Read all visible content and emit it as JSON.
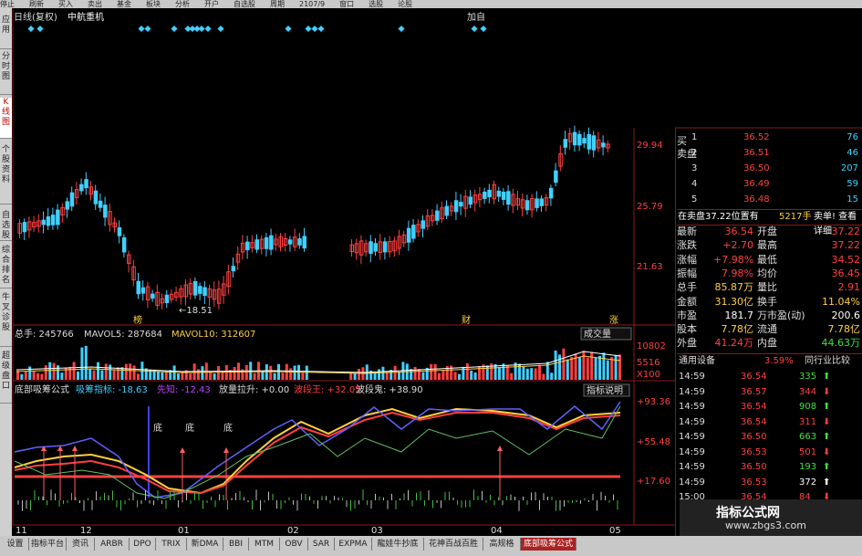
{
  "menubar": [
    "停止",
    "刷新",
    "买入",
    "卖出",
    "基金",
    "板块",
    "分析",
    "开户",
    "自选股",
    "周期",
    "2107/9",
    "窗口",
    "选股",
    "论股"
  ],
  "sidebar": [
    {
      "label": "应用",
      "active": false
    },
    {
      "label": "分时图",
      "active": false
    },
    {
      "label": "K线图",
      "active": true
    },
    {
      "label": "个股资料",
      "active": false
    },
    {
      "label": "自选股",
      "active": false
    },
    {
      "label": "综合排名",
      "active": false
    },
    {
      "label": "牛叉诊股",
      "active": false
    },
    {
      "label": "超级盘口",
      "active": false
    }
  ],
  "chart": {
    "period": "日线(复权)",
    "stock_name": "中航重机",
    "add_label": "加自",
    "price_axis": [
      "29.94",
      "25.79",
      "21.63"
    ],
    "low_marker": "←18.51",
    "event_marks": [
      "榜",
      "财",
      "涨"
    ]
  },
  "volume_panel": {
    "total": "总手: 245766",
    "mavol5": "MAVOL5: 287684",
    "mavol10": "MAVOL10: 312607",
    "dropdown": "成交量",
    "axis": [
      "10802",
      "5516",
      "X100"
    ]
  },
  "indicator_panel": {
    "name": "底部吸筹公式",
    "absorb": "吸筹指标: -18.63",
    "pioneer": "先知: -12.43",
    "volume_up": "放量拉升: +0.00",
    "bull": "波段王: +32.05",
    "wave": "波段鬼: +38.90",
    "help_button": "指标说明",
    "axis": [
      "+93.36",
      "+55.48",
      "+17.60"
    ],
    "bottom_marks": [
      "底",
      "底",
      "底"
    ],
    "dates": [
      "11",
      "12",
      "01",
      "02",
      "03",
      "04",
      "05"
    ]
  },
  "orderbook": {
    "sell_label": "卖盘",
    "buy_label": "买",
    "sell": [
      {
        "level": "1",
        "price": "36.52",
        "vol": "76"
      },
      {
        "level": "2",
        "price": "36.51",
        "vol": "46"
      },
      {
        "level": "3",
        "price": "36.50",
        "vol": "207"
      },
      {
        "level": "4",
        "price": "36.49",
        "vol": "59"
      },
      {
        "level": "5",
        "price": "36.48",
        "vol": "15"
      }
    ],
    "summary_left": "在卖盘37.22位置有",
    "summary_mid": "5217手",
    "summary_right": "卖单! 查看详细"
  },
  "quote": [
    {
      "k": "最新",
      "v": "36.54",
      "vc": "red",
      "k2": "开盘",
      "v2": "37.22",
      "v2c": "red"
    },
    {
      "k": "涨跌",
      "v": "+2.70",
      "vc": "red",
      "k2": "最高",
      "v2": "37.22",
      "v2c": "red"
    },
    {
      "k": "涨幅",
      "v": "+7.98%",
      "vc": "red",
      "k2": "最低",
      "v2": "34.52",
      "v2c": "red"
    },
    {
      "k": "振幅",
      "v": "7.98%",
      "vc": "red",
      "k2": "均价",
      "v2": "36.45",
      "v2c": "red"
    },
    {
      "k": "总手",
      "v": "85.87万",
      "vc": "yellow",
      "k2": "量比",
      "v2": "2.91",
      "v2c": "red"
    },
    {
      "k": "金额",
      "v": "31.30亿",
      "vc": "yellow",
      "k2": "换手",
      "v2": "11.04%",
      "v2c": "yellow"
    },
    {
      "k": "市盈",
      "v": "181.7",
      "vc": "white",
      "k2": "万市盈(动)",
      "v2": "200.6",
      "v2c": "white"
    },
    {
      "k": "股本",
      "v": "7.78亿",
      "vc": "yellow",
      "k2": "流通",
      "v2": "7.78亿",
      "v2c": "yellow"
    },
    {
      "k": "外盘",
      "v": "41.24万",
      "vc": "red",
      "k2": "内盘",
      "v2": "44.63万",
      "v2c": "green"
    }
  ],
  "ticks_header": {
    "left": "通用设备",
    "mid": "3.59%",
    "right": "同行业比较"
  },
  "ticks": [
    {
      "time": "14:59",
      "price": "36.54",
      "vol": "335",
      "dir": "up"
    },
    {
      "time": "14:59",
      "price": "36.57",
      "vol": "344",
      "dir": "down"
    },
    {
      "time": "14:59",
      "price": "36.54",
      "vol": "908",
      "dir": "up"
    },
    {
      "time": "14:59",
      "price": "36.54",
      "vol": "311",
      "dir": "down"
    },
    {
      "time": "14:59",
      "price": "36.50",
      "vol": "663",
      "dir": "up"
    },
    {
      "time": "14:59",
      "price": "36.53",
      "vol": "501",
      "dir": "down"
    },
    {
      "time": "14:59",
      "price": "36.50",
      "vol": "193",
      "dir": "up"
    },
    {
      "time": "14:59",
      "price": "36.53",
      "vol": "372",
      "dir": "up-white"
    },
    {
      "time": "15:00",
      "price": "36.54",
      "vol": "84",
      "dir": "down"
    }
  ],
  "bottom_tabs": [
    "设置",
    "指标平台",
    "资讯",
    "ARBR",
    "DPO",
    "TRIX",
    "新DMA",
    "BBI",
    "MTM",
    "OBV",
    "SAR",
    "EXPMA",
    "龍娃牛抄底",
    "花神百战百胜",
    "高规格",
    "底部吸筹公式"
  ],
  "watermark": {
    "text": "指标公式网",
    "url": "www.zbgs3.com"
  },
  "colors": {
    "up": "#ff4040",
    "down": "#40d0ff",
    "frame": "#8b1a1a",
    "ma_white": "#ffffff",
    "ma_yellow": "#ffd040"
  }
}
